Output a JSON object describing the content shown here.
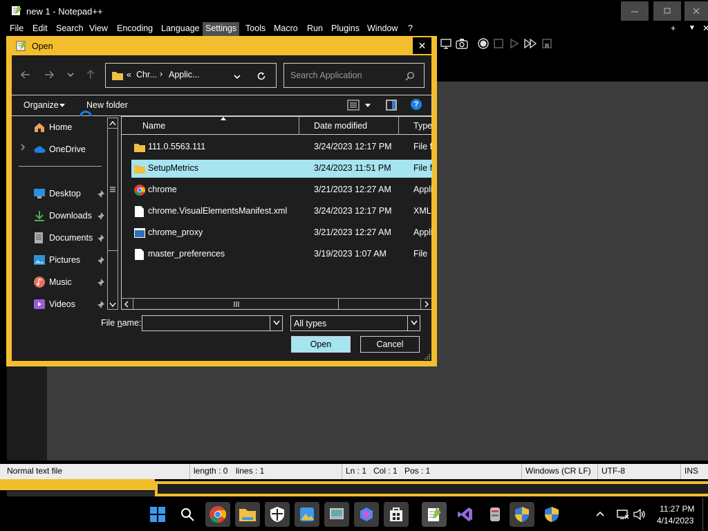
{
  "app": {
    "title": "new 1 - Notepad++"
  },
  "menu": [
    "File",
    "Edit",
    "Search",
    "View",
    "Encoding",
    "Language",
    "Settings",
    "Tools",
    "Macro",
    "Run",
    "Plugins",
    "Window",
    "?"
  ],
  "menu_right": {
    "plus": "+",
    "down": "▼",
    "close": "✕"
  },
  "status": {
    "type": "Normal text file",
    "length": "length : 0",
    "lines": "lines : 1",
    "ln": "Ln : 1",
    "col": "Col : 1",
    "pos": "Pos : 1",
    "eol": "Windows (CR LF)",
    "enc": "UTF-8",
    "ins": "INS"
  },
  "dialog": {
    "title": "Open",
    "close": "✕",
    "crumb": {
      "prefix": "«",
      "part1": "Chr...",
      "sep": "›",
      "part2": "Applic..."
    },
    "search_placeholder": "Search Application",
    "organize": "Organize",
    "new_folder": "New folder",
    "help": "?",
    "columns": {
      "name": "Name",
      "date": "Date modified",
      "type": "Type"
    },
    "files": [
      {
        "name": "111.0.5563.111",
        "date": "3/24/2023 12:17 PM",
        "type": "File fo",
        "icon": "folder"
      },
      {
        "name": "SetupMetrics",
        "date": "3/24/2023 11:51 PM",
        "type": "File fo",
        "icon": "folder",
        "selected": true
      },
      {
        "name": "chrome",
        "date": "3/21/2023 12:27 AM",
        "type": "Applic",
        "icon": "chrome"
      },
      {
        "name": "chrome.VisualElementsManifest.xml",
        "date": "3/24/2023 12:17 PM",
        "type": "XML",
        "icon": "file"
      },
      {
        "name": "chrome_proxy",
        "date": "3/21/2023 12:27 AM",
        "type": "Applic",
        "icon": "app"
      },
      {
        "name": "master_preferences",
        "date": "3/19/2023 1:07 AM",
        "type": "File",
        "icon": "file"
      }
    ],
    "nav": {
      "home": "Home",
      "onedrive": "OneDrive",
      "desktop": "Desktop",
      "downloads": "Downloads",
      "documents": "Documents",
      "pictures": "Pictures",
      "music": "Music",
      "videos": "Videos"
    },
    "filename_label_pre": "File ",
    "filename_label_u": "n",
    "filename_label_post": "ame:",
    "filename_value": "",
    "filetype": "All types",
    "open": "Open",
    "cancel": "Cancel"
  },
  "tray": {
    "time": "11:27 PM",
    "date": "4/14/2023"
  },
  "colors": {
    "accent": "#f3be2e",
    "selected_row": "#a6e4f0",
    "open_btn": "#a6e4f0"
  }
}
